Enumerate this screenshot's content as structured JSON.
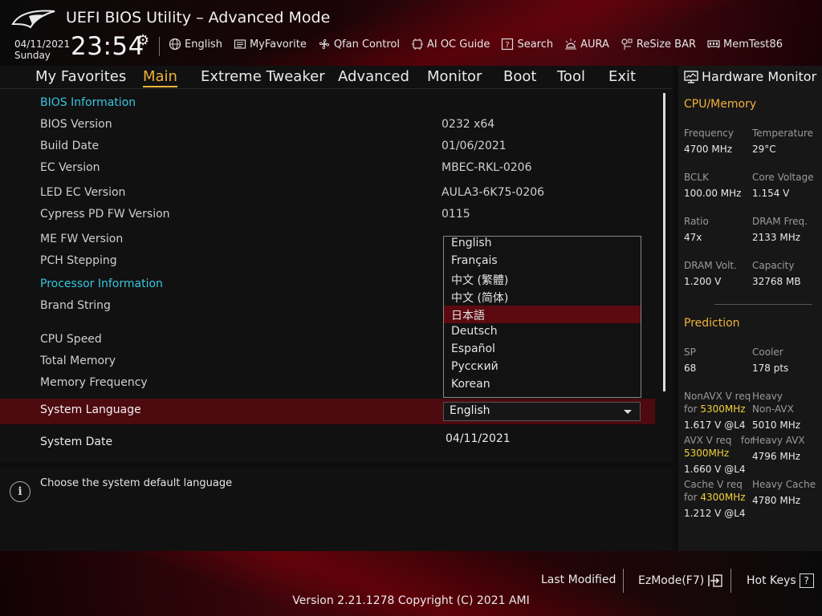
{
  "app": {
    "title": "UEFI BIOS Utility – Advanced Mode",
    "date": "04/11/2021",
    "day": "Sunday",
    "time": "23:54"
  },
  "toolbar": {
    "language": "English",
    "myfavorite": "MyFavorite",
    "qfan": "Qfan Control",
    "aioc": "AI OC Guide",
    "search": "Search",
    "aura": "AURA",
    "resizebar": "ReSize BAR",
    "memtest": "MemTest86"
  },
  "nav": {
    "tabs": [
      "My Favorites",
      "Main",
      "Extreme Tweaker",
      "Advanced",
      "Monitor",
      "Boot",
      "Tool",
      "Exit"
    ],
    "active": "Main"
  },
  "main": {
    "bios_info_header": "BIOS Information",
    "bios_version_label": "BIOS Version",
    "bios_version": "0232  x64",
    "build_date_label": "Build Date",
    "build_date": "01/06/2021",
    "ec_version_label": "EC Version",
    "ec_version": "MBEC-RKL-0206",
    "led_ec_label": "LED EC Version",
    "led_ec": "AULA3-6K75-0206",
    "cypress_label": "Cypress PD FW Version",
    "cypress": "0115",
    "me_fw_label": "ME FW Version",
    "pch_label": "PCH Stepping",
    "proc_info_header": "Processor Information",
    "brand_label": "Brand String",
    "cpu_speed_label": "CPU Speed",
    "total_mem_label": "Total Memory",
    "mem_freq_label": "Memory Frequency",
    "sys_lang_label": "System Language",
    "sys_lang_value": "English",
    "sys_date_label": "System Date",
    "sys_date_value": "04/11/2021"
  },
  "language_dropdown": {
    "options": [
      "English",
      "Français",
      "中文 (繁體)",
      "中文 (简体)",
      "日本語",
      "Deutsch",
      "Español",
      "Русский",
      "Korean"
    ],
    "highlighted": "日本語"
  },
  "help": {
    "text": "Choose the system default language"
  },
  "hardware_monitor": {
    "title": "Hardware Monitor",
    "cpu_mem": {
      "header": "CPU/Memory",
      "frequency_label": "Frequency",
      "frequency": "4700 MHz",
      "temperature_label": "Temperature",
      "temperature": "29°C",
      "bclk_label": "BCLK",
      "bclk": "100.00 MHz",
      "core_voltage_label": "Core Voltage",
      "core_voltage": "1.154 V",
      "ratio_label": "Ratio",
      "ratio": "47x",
      "dram_freq_label": "DRAM Freq.",
      "dram_freq": "2133 MHz",
      "dram_volt_label": "DRAM Volt.",
      "dram_volt": "1.200 V",
      "capacity_label": "Capacity",
      "capacity": "32768 MB"
    },
    "prediction": {
      "header": "Prediction",
      "sp_label": "SP",
      "sp": "68",
      "cooler_label": "Cooler",
      "cooler": "178 pts",
      "nonavx_label_a": "NonAVX V req",
      "nonavx_label_b": "for",
      "nonavx_freq": "5300MHz",
      "nonavx_value": "1.617 V @L4",
      "heavy_nonavx_label_a": "Heavy",
      "heavy_nonavx_label_b": "Non-AVX",
      "heavy_nonavx_value": "5010 MHz",
      "avx_label": "AVX V req",
      "avx_for": "for",
      "avx_freq": "5300MHz",
      "avx_value": "1.660 V @L4",
      "heavy_avx_label": "Heavy AVX",
      "heavy_avx_value": "4796 MHz",
      "cache_label_a": "Cache V req",
      "cache_label_b": "for",
      "cache_freq": "4300MHz",
      "cache_value": "1.212 V @L4",
      "heavy_cache_label": "Heavy Cache",
      "heavy_cache_value": "4780 MHz"
    }
  },
  "footer": {
    "last_modified": "Last Modified",
    "ezmode": "EzMode(F7)",
    "hotkeys": "Hot Keys",
    "hotkeys_key": "?",
    "version": "Version 2.21.1278 Copyright (C) 2021 AMI"
  },
  "colors": {
    "accent": "#f0b23a",
    "section": "#39c6e0",
    "highlight": "#5c0a10"
  }
}
